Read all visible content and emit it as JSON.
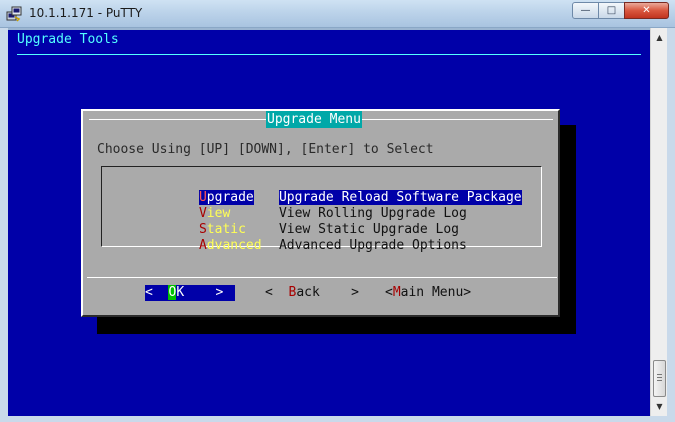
{
  "window": {
    "title": "10.1.1.171 - PuTTY",
    "min_glyph": "—",
    "max_glyph": "□",
    "close_glyph": "✕"
  },
  "terminal": {
    "header": "Upgrade Tools",
    "bg_color": "#0000a8",
    "text_color": "#54ffff"
  },
  "dialog": {
    "title": "Upgrade Menu",
    "prompt": "Choose Using [UP] [DOWN], [Enter] to Select",
    "items": [
      {
        "hotkey": "U",
        "rest": "pgrade",
        "description": "Upgrade Reload Software Package",
        "selected": true
      },
      {
        "hotkey": "V",
        "rest": "iew",
        "description": "View Rolling Upgrade Log",
        "selected": false
      },
      {
        "hotkey": "S",
        "rest": "tatic",
        "description": "View Static Upgrade Log",
        "selected": false
      },
      {
        "hotkey": "A",
        "rest": "dvanced",
        "description": "Advanced Upgrade Options",
        "selected": false
      }
    ],
    "buttons": {
      "ok": {
        "left": "<  ",
        "cursor": "O",
        "rest": "K    >"
      },
      "back": {
        "left": "<  ",
        "hotkey": "B",
        "rest": "ack    >"
      },
      "main": {
        "left": "<",
        "hotkey": "M",
        "rest": "ain Menu>"
      }
    }
  },
  "scrollbar": {
    "up_glyph": "▲",
    "down_glyph": "▼"
  }
}
